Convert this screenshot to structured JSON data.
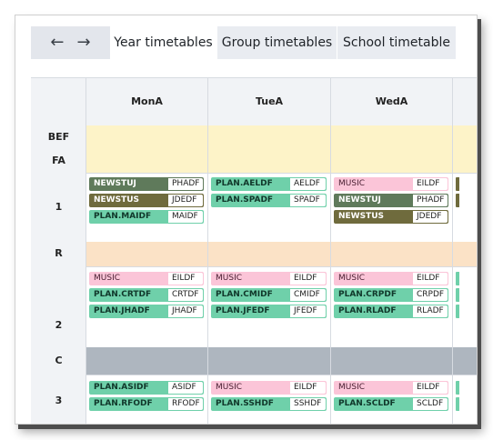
{
  "nav": {
    "back": "←",
    "forward": "→"
  },
  "tabs": [
    {
      "label": "Year timetables",
      "active": true
    },
    {
      "label": "Group timetables",
      "active": false
    },
    {
      "label": "School timetable",
      "active": false
    }
  ],
  "days": [
    "MonA",
    "TueA",
    "WedA"
  ],
  "periods": {
    "bef": "BEF",
    "fa": "FA",
    "p1": "1",
    "r": "R",
    "p2": "2",
    "c": "C",
    "p3": "3"
  },
  "colors": {
    "yellow_row": "#fdf3c8",
    "orange_row": "#fbe2c6",
    "grey_row": "#aeb6bf",
    "plan": "#6fd0aa",
    "music": "#fbc5d8",
    "newstuj": "#5f7a5b",
    "newstus": "#6f6b3d"
  },
  "p1": {
    "mon": [
      {
        "name": "NEWSTUJ",
        "code": "PHADF"
      },
      {
        "name": "NEWSTUS",
        "code": "JDEDF"
      },
      {
        "name": "PLAN.MAIDF",
        "code": "MAIDF"
      }
    ],
    "tue": [
      {
        "name": "PLAN.AELDF",
        "code": "AELDF"
      },
      {
        "name": "PLAN.SPADF",
        "code": "SPADF"
      }
    ],
    "wed": [
      {
        "name": "MUSIC",
        "code": "EILDF"
      },
      {
        "name": "NEWSTUJ",
        "code": "PHADF"
      },
      {
        "name": "NEWSTUS",
        "code": "JDEDF"
      }
    ]
  },
  "p2": {
    "mon": [
      {
        "name": "MUSIC",
        "code": "EILDF"
      },
      {
        "name": "PLAN.CRTDF",
        "code": "CRTDF"
      },
      {
        "name": "PLAN.JHADF",
        "code": "JHADF"
      }
    ],
    "tue": [
      {
        "name": "MUSIC",
        "code": "EILDF"
      },
      {
        "name": "PLAN.CMIDF",
        "code": "CMIDF"
      },
      {
        "name": "PLAN.JFEDF",
        "code": "JFEDF"
      }
    ],
    "wed": [
      {
        "name": "MUSIC",
        "code": "EILDF"
      },
      {
        "name": "PLAN.CRPDF",
        "code": "CRPDF"
      },
      {
        "name": "PLAN.RLADF",
        "code": "RLADF"
      }
    ]
  },
  "p3": {
    "mon": [
      {
        "name": "PLAN.ASIDF",
        "code": "ASIDF"
      },
      {
        "name": "PLAN.RFODF",
        "code": "RFODF"
      }
    ],
    "tue": [
      {
        "name": "MUSIC",
        "code": "EILDF"
      },
      {
        "name": "PLAN.SSHDF",
        "code": "SSHDF"
      }
    ],
    "wed": [
      {
        "name": "MUSIC",
        "code": "EILDF"
      },
      {
        "name": "PLAN.SCLDF",
        "code": "SCLDF"
      }
    ]
  }
}
